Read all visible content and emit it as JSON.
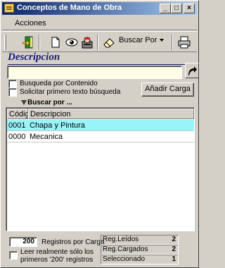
{
  "window": {
    "title": "Conceptos de Mano de Obra",
    "controls": {
      "minimize": "_",
      "maximize": "□",
      "close": "×"
    }
  },
  "menu": {
    "acciones": "Acciones"
  },
  "toolbar": {
    "buscar_por": "Buscar Por",
    "icons": [
      "grip-icon",
      "exit-door-icon",
      "new-document-icon",
      "view-eye-icon",
      "user-icon",
      "eraser-icon",
      "printer-icon"
    ]
  },
  "search": {
    "section_title": "Descripcion",
    "input_value": "",
    "checkbox_contenido": "Busqueda por Contenido",
    "checkbox_primero": "Solicitar primero texto búsqueda",
    "anadir_carga": "Añadir Carga",
    "buscar_por": "Buscar por ..."
  },
  "table": {
    "columns": [
      "Códig",
      "Descripcion"
    ],
    "rows": [
      {
        "codigo": "0001",
        "descripcion": "Chapa y Pintura",
        "selected": true
      },
      {
        "codigo": "0000",
        "descripcion": "Mecanica",
        "selected": false
      }
    ]
  },
  "footer": {
    "registros_value": "200",
    "registros_label": "Registros por Carga",
    "leer_label_1": "Leer realmente sólo los",
    "leer_label_2": "primeros '200' registros",
    "stats": [
      {
        "label": "Reg.Leídos",
        "value": "2"
      },
      {
        "label": "Reg.Cargados",
        "value": "2"
      },
      {
        "label": "Seleccionado",
        "value": "1"
      }
    ]
  },
  "colors": {
    "title_bar_start": "#0a246a",
    "title_bar_end": "#a6caf0",
    "selected_row": "#99f4f8",
    "input_background": "#ffffe8",
    "section_title": "#1a1a7a"
  }
}
